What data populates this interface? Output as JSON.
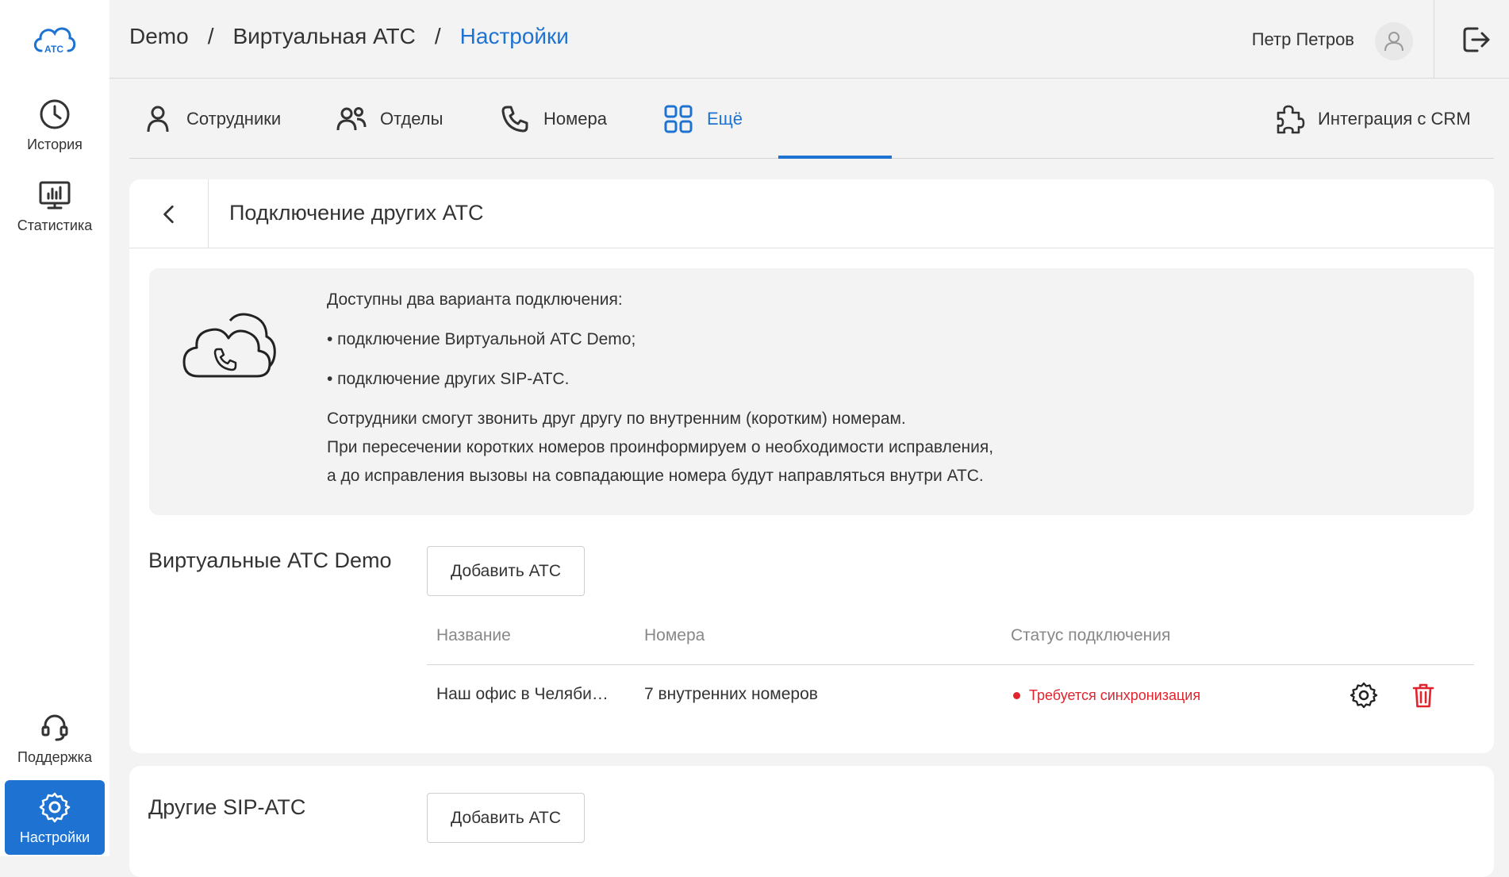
{
  "app": {
    "logo_text": "АТС"
  },
  "sidebar": {
    "items": [
      {
        "label": "История",
        "icon": "clock-icon"
      },
      {
        "label": "Статистика",
        "icon": "chart-monitor-icon"
      },
      {
        "label": "Поддержка",
        "icon": "headset-icon"
      },
      {
        "label": "Настройки",
        "icon": "gear-icon",
        "active": true
      }
    ]
  },
  "header": {
    "breadcrumb": [
      "Demo",
      "Виртуальная АТС",
      "Настройки"
    ],
    "separator": "/",
    "user_name": "Петр Петров"
  },
  "tabs": [
    {
      "label": "Сотрудники",
      "icon": "person-icon"
    },
    {
      "label": "Отделы",
      "icon": "people-icon"
    },
    {
      "label": "Номера",
      "icon": "phone-icon"
    },
    {
      "label": "Ещё",
      "icon": "grid-icon",
      "active": true
    },
    {
      "label": "Интеграция с CRM",
      "icon": "puzzle-icon"
    }
  ],
  "page": {
    "title": "Подключение других АТС",
    "info": {
      "lines": [
        "Доступны два варианта подключения:",
        "• подключение Виртуальной АТС Demo;",
        "• подключение других SIP-АТС.",
        "Сотрудники смогут звонить друг другу по внутренним (коротким) номерам.",
        "При пересечении коротких номеров проинформируем о необходимости исправления,",
        "а до исправления вызовы на совпадающие номера будут направляться внутри АТС."
      ]
    },
    "virtual_section": {
      "title": "Виртуальные АТС Demo",
      "add_label": "Добавить АТС",
      "columns": [
        "Название",
        "Номера",
        "Статус подключения"
      ],
      "rows": [
        {
          "name": "Наш офис в Челяби…",
          "numbers": "7 внутренних номеров",
          "status": "Требуется синхронизация"
        }
      ]
    },
    "sip_section": {
      "title": "Другие SIP-АТС",
      "add_label": "Добавить АТС"
    }
  },
  "colors": {
    "accent": "#1e73d2",
    "danger": "#e0232d",
    "background": "#f2f3f2"
  }
}
